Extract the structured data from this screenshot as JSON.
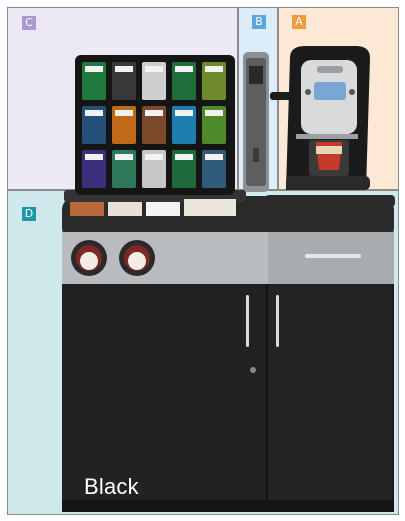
{
  "zones": [
    {
      "id": "c",
      "label": "C",
      "color": "#a99ad0"
    },
    {
      "id": "b",
      "label": "B",
      "color": "#5aa7e0"
    },
    {
      "id": "a",
      "label": "A",
      "color": "#f29a3a"
    },
    {
      "id": "d",
      "label": "D",
      "color": "#1a97a8"
    }
  ],
  "caption": "Black",
  "icons": [
    "coffee-brewer",
    "cup-dispenser",
    "beverage-pack-rack",
    "condiment-tray",
    "storage-cabinet"
  ],
  "colors": {
    "cabinet": "#1c1c1c",
    "trim": "#b9bcbf",
    "accent_cup": "#c43a2b"
  }
}
